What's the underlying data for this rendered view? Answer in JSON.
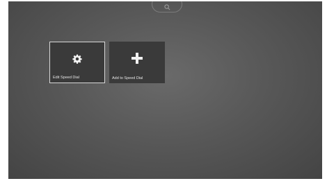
{
  "search": {
    "icon": "search-icon"
  },
  "speed_dial": {
    "tiles": [
      {
        "label": "Edit Speed Dial",
        "icon": "gear-icon",
        "selected": true
      },
      {
        "label": "Add to Speed Dial",
        "icon": "plus-icon",
        "selected": false
      }
    ]
  },
  "colors": {
    "background_center": "#6a6a6a",
    "background_edge": "#444444",
    "tile_background": "#3a3a3a",
    "selected_border": "#d9d9d9",
    "icon": "#f2f2f2"
  }
}
